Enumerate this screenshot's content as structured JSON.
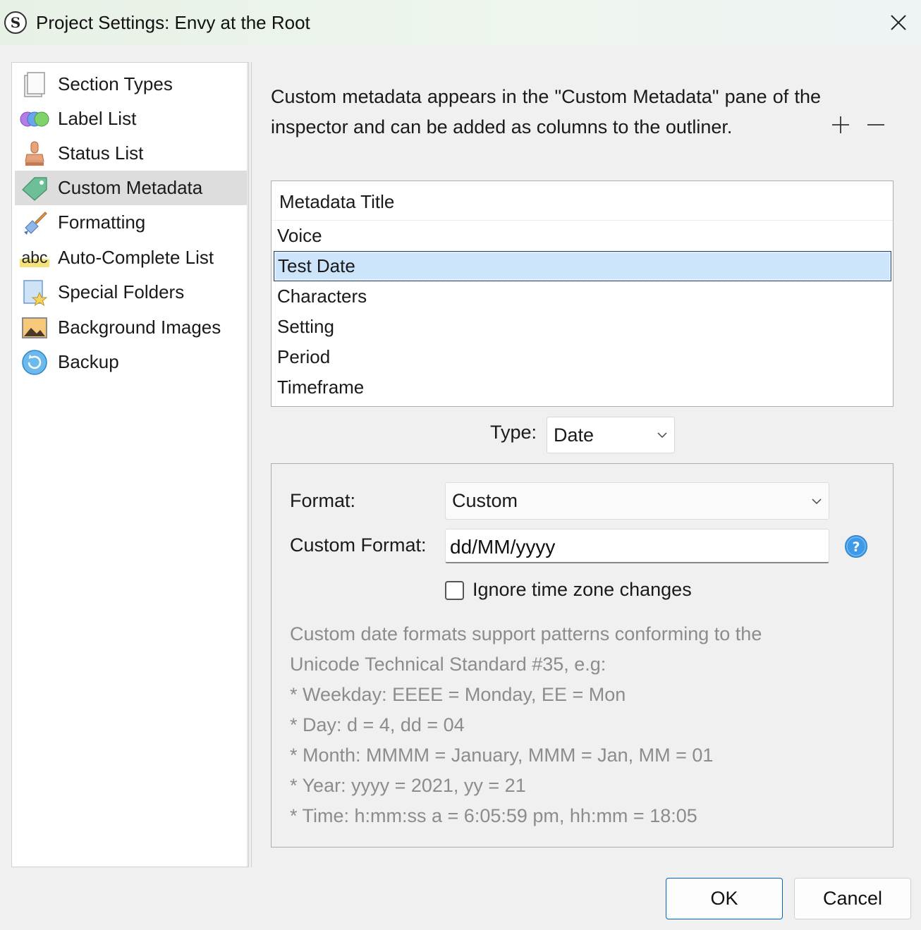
{
  "window": {
    "title": "Project Settings: Envy at the Root",
    "app_icon_letter": "S"
  },
  "sidebar": {
    "items": [
      {
        "label": "Section Types",
        "icon": "section-types-icon"
      },
      {
        "label": "Label List",
        "icon": "label-list-icon"
      },
      {
        "label": "Status List",
        "icon": "status-stamp-icon"
      },
      {
        "label": "Custom Metadata",
        "icon": "metadata-tag-icon",
        "selected": true
      },
      {
        "label": "Formatting",
        "icon": "formatting-brush-icon"
      },
      {
        "label": "Auto-Complete List",
        "icon": "abc-icon",
        "icon_text": "abc"
      },
      {
        "label": "Special Folders",
        "icon": "special-folder-star-icon"
      },
      {
        "label": "Background Images",
        "icon": "background-image-icon"
      },
      {
        "label": "Backup",
        "icon": "backup-icon"
      }
    ]
  },
  "main": {
    "description": "Custom metadata appears in the \"Custom Metadata\" pane of the inspector and can be added as columns to the outliner.",
    "table": {
      "header": "Metadata Title",
      "rows": [
        "Voice",
        "Test Date",
        "Characters",
        "Setting",
        "Period",
        "Timeframe"
      ],
      "selected_index": 1
    },
    "type": {
      "label": "Type:",
      "value": "Date"
    },
    "format": {
      "label": "Format:",
      "value": "Custom"
    },
    "custom_format": {
      "label": "Custom Format:",
      "value": "dd/MM/yyyy"
    },
    "ignore_tz": {
      "label": "Ignore time zone changes",
      "checked": false
    },
    "hint_lines": [
      "Custom date formats support patterns conforming to the",
      "Unicode Technical Standard #35, e.g:",
      "* Weekday: EEEE = Monday, EE = Mon",
      "* Day: d = 4, dd = 04",
      "* Month: MMMM = January, MMM = Jan, MM = 01",
      "* Year: yyyy = 2021, yy = 21",
      "* Time: h:mm:ss a = 6:05:59 pm, hh:mm = 18:05"
    ]
  },
  "buttons": {
    "ok": "OK",
    "cancel": "Cancel"
  },
  "colors": {
    "selection": "#cce5fb",
    "accent": "#0067c0",
    "help": "#3d9ae8",
    "hint_text": "#8c8c8c"
  }
}
